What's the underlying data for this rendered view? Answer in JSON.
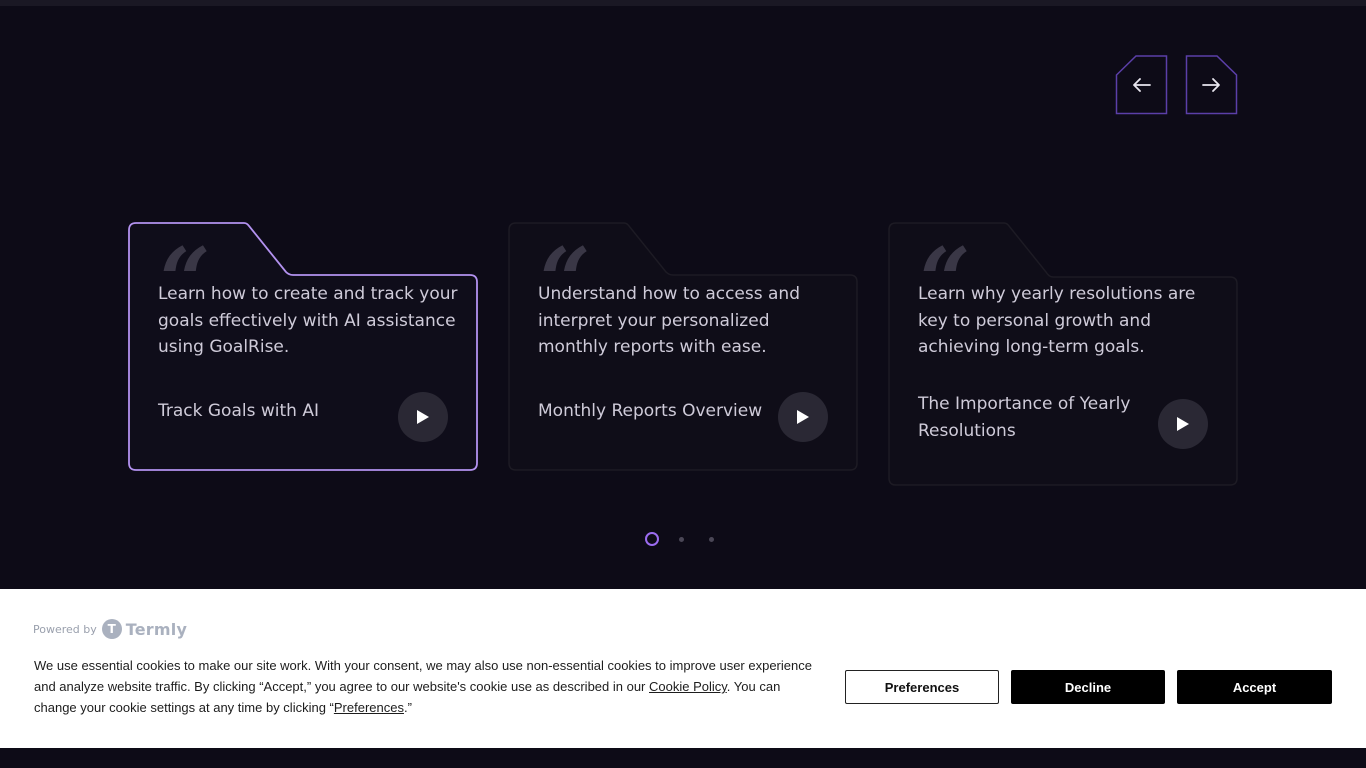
{
  "navigation": {
    "prev_icon": "arrow-left-icon",
    "next_icon": "arrow-right-icon",
    "accent_color": "#6b46c1"
  },
  "cards": [
    {
      "description": "Learn how to create and track your goals effectively with AI assistance using GoalRise.",
      "title": "Track Goals with AI",
      "active": true
    },
    {
      "description": "Understand how to access and interpret your personalized monthly reports with ease.",
      "title": "Monthly Reports Overview",
      "active": false
    },
    {
      "description": "Learn why yearly resolutions are key to personal growth and achieving long-term goals.",
      "title": "The Importance of Yearly Resolutions",
      "active": false
    }
  ],
  "pagination": {
    "total": 3,
    "active_index": 0,
    "active_color": "#9b6cf0"
  },
  "cookie_banner": {
    "powered_by": "Powered by",
    "brand": "Termly",
    "text_part1": "We use essential cookies to make our site work. With your consent, we may also use non-essential cookies to improve user experience and analyze website traffic. By clicking “Accept,” you agree to our website's cookie use as described in our ",
    "cookie_policy_link": "Cookie Policy",
    "text_part2": ". You can change your cookie settings at any time by clicking “",
    "preferences_link": "Preferences",
    "text_part3": ".”",
    "buttons": {
      "preferences": "Preferences",
      "decline": "Decline",
      "accept": "Accept"
    }
  }
}
